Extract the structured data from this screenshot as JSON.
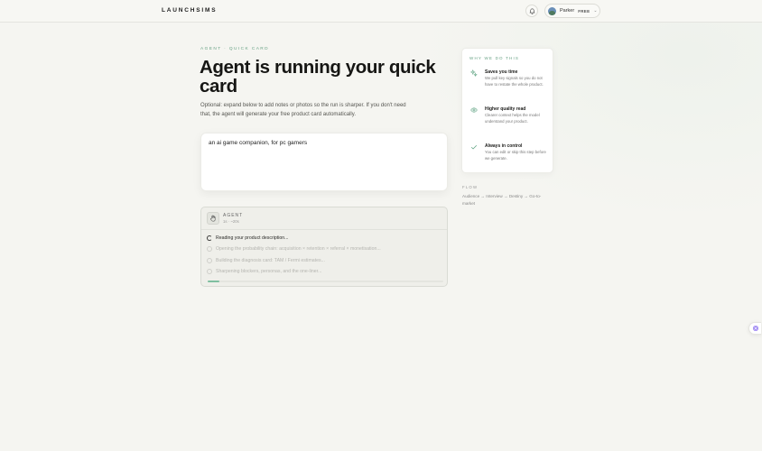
{
  "header": {
    "logo": "LAUNCHSIMS",
    "user": {
      "name": "Parker",
      "plan": "FREE"
    },
    "icons": {
      "notifications": "bell-icon",
      "avatar": "avatar",
      "menu": "chevron-down-icon"
    }
  },
  "main": {
    "eyebrow": "AGENT · QUICK CARD",
    "title": "Agent is running your quick card",
    "subtitle": "Optional: expand below to add notes or photos so the run is sharper. If you don't need that, the agent will generate your free product card automatically.",
    "input_text": "an ai game companion, for pc gamers"
  },
  "agent": {
    "label": "AGENT",
    "time": "1s · ~20s",
    "progress_fraction": 0.05,
    "steps": [
      {
        "text": "Reading your product description...",
        "state": "active"
      },
      {
        "text": "Opening the probability chain: acquisition × retention × referral × monetisation...",
        "state": "pending"
      },
      {
        "text": "Building the diagnosis card: TAM / Fermi estimates...",
        "state": "pending"
      },
      {
        "text": "Sharpening blockers, personas, and the one-liner...",
        "state": "pending"
      }
    ]
  },
  "why": {
    "title": "WHY WE DO THIS",
    "items": [
      {
        "icon": "sparkle-icon",
        "heading": "Saves you time",
        "body": "We pull key signals so you do not have to restate the whole product."
      },
      {
        "icon": "eye-icon",
        "heading": "Higher quality read",
        "body": "Clearer context helps the model understand your product."
      },
      {
        "icon": "check-icon",
        "heading": "Always in control",
        "body": "You can edit or skip this step before we generate."
      }
    ]
  },
  "flow": {
    "label": "FLOW",
    "text": "Audience → Interview → Destiny → Go-to-market"
  },
  "colors": {
    "accent": "#6aa386",
    "progress": "#7fbfa0",
    "background": "#f5f5f1"
  }
}
